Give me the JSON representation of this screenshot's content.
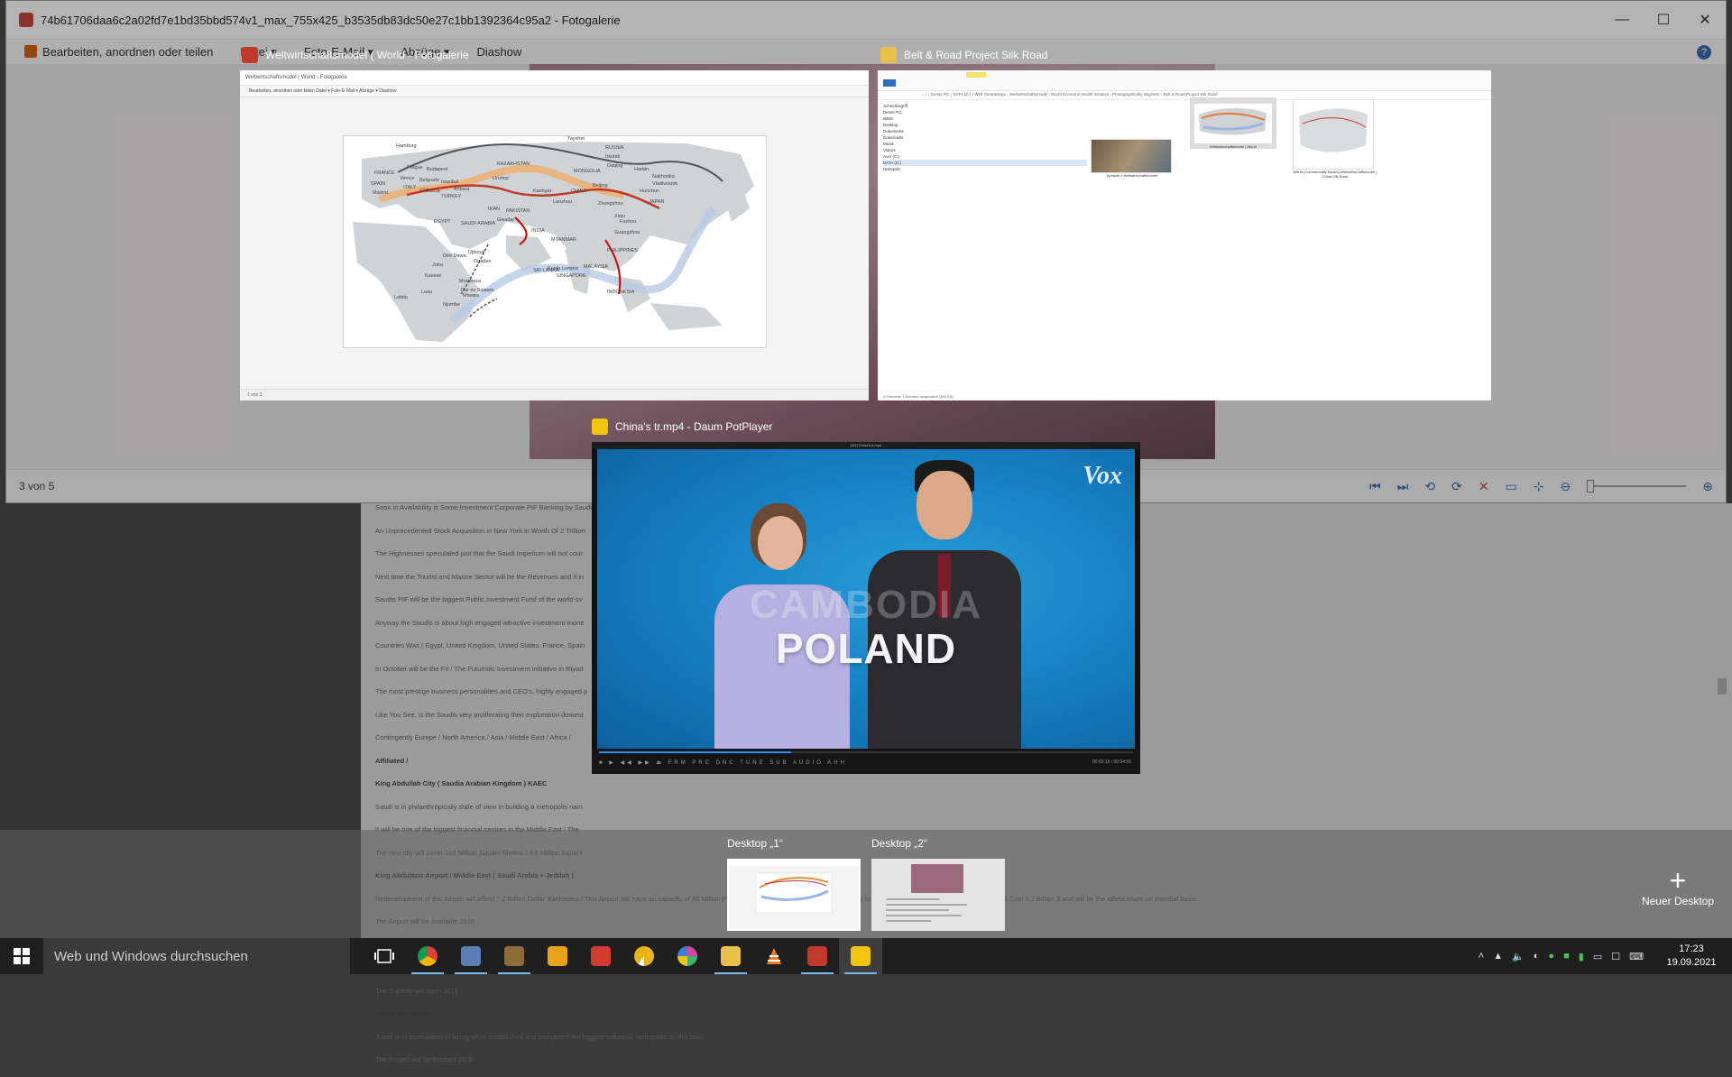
{
  "background_window": {
    "title": "74b61706daa6c2a02fd7e1bd35bbd574v1_max_755x425_b3535db83dc50e27c1bb1392364c95a2 - Fotogalerie",
    "menu": [
      {
        "label": "Bearbeiten, anordnen oder teilen"
      },
      {
        "label": "Datei ▾"
      },
      {
        "label": "Foto-E-Mail ▾"
      },
      {
        "label": "Abzüge ▾"
      },
      {
        "label": "Diashow"
      }
    ],
    "help": "?",
    "status_count": "3 von 5",
    "window_controls": {
      "minimize": "—",
      "maximize": "☐",
      "close": "✕"
    },
    "status_controls": [
      "⏮",
      "⏭",
      "⟲",
      "⟳",
      "✕",
      "▭",
      "⊹",
      "⊖",
      "⊕"
    ]
  },
  "document_text": [
    {
      "text": "Soon in Availability is Some Investment Corporate PIF Banking by Saudi",
      "bold": false
    },
    {
      "text": "An Unprecedented Stock Acquisition in New York in Worth Of 2 Trillion",
      "bold": false
    },
    {
      "text": "The Highnesses speculated just that the Saudi Imperium will not cour",
      "bold": false
    },
    {
      "text": "Next time the Tourist and Marine Sector will be the Revenues and if in",
      "bold": false
    },
    {
      "text": "Saudis PIF will be the biggest Public Investment Fund of the world ov",
      "bold": false
    },
    {
      "text": "Anyway the Saudis is about high engaged attractive investment mone",
      "bold": false
    },
    {
      "text": "Countries Was ( Egypt, United Kingdom, United States, France, Spain",
      "bold": false
    },
    {
      "text": "In October will be the FII / The Futuristic Investment Initiative in Riyad",
      "bold": false
    },
    {
      "text": "The most prestige business personalities and CEO's, highly engaged p",
      "bold": false
    },
    {
      "text": "Like You See, is the Saudis very proliferating their exploration domest",
      "bold": false
    },
    {
      "text": "Contingently Europe / North America / Asia / Middle East / Africa /",
      "bold": false
    },
    {
      "text": "Affiliated /",
      "bold": true
    },
    {
      "text": "King Abdullah City ( Saudia Arabian Kingdom ) KAEC",
      "bold": true
    },
    {
      "text": "Saudi is in philanthropically state of view in building a metropolis nam",
      "bold": false
    },
    {
      "text": "It will be one of the biggest financial centres in the Middle East / The",
      "bold": false
    },
    {
      "text": "The new city will cover 168 Million Square Meters / 4.5 Million Square",
      "bold": false
    },
    {
      "text": "King Abdulaziz Airport / Middle East ( Saudi Arabia + Jeddah )",
      "bold": true
    },
    {
      "text": "Redevelopment of this Airport will afford 7.2 Billion Dollar Banknotes / This Airport will have an capacity of 80 Million Passengers / This Airport will be in connectivity to an High Speed Train / The Control Tower Will Cost 3.2 Billion $ and will be the tallest tower on mondial basis.",
      "bold": false
    },
    {
      "text": "The Airport will be available 2018",
      "bold": false
    },
    {
      "text": "Riyadh Subway ( Saudi )",
      "bold": true
    },
    {
      "text": "The Construction Prize is estimated 22.5 Billion Dollar Bills",
      "bold": false
    },
    {
      "text": "The Subway will open 2019",
      "bold": false
    },
    {
      "text": "Jubail City Center",
      "bold": true
    },
    {
      "text": "Jubail is in speculation of being when established and completed the biggest industrial metropolis on this plan",
      "bold": false
    },
    {
      "text": "The Project will be finished 2026",
      "bold": false
    }
  ],
  "task_view": {
    "windows": [
      {
        "title": "Weltwirtschaftsmodel ( World - Fotogalerie",
        "inner_title": "Weltwirtschaftsmodel ( World - Fotogalerie",
        "inner_menu": "Bearbeiten, anordnen oder teilen     Datei ▾     Foto-E-Mail ▾     Abzüge ▾     Diashow",
        "inner_status": "1 von 3",
        "map_labels": {
          "hamburg": "Hamburg",
          "russia": "RUSSIA",
          "irkutsk": "Irkutsk",
          "tayshet": "Tayshet",
          "kazakhstan": "KAZAKHSTAN",
          "mongolia": "MONGOLIA",
          "prague": "Prague",
          "budapest": "Budapest",
          "france": "FRANCE",
          "venice": "Venice",
          "italy": "ITALY",
          "belgrade": "Belgrade",
          "istanbul": "Istanbul",
          "ankara": "Ankara",
          "greece": "GREECE",
          "turkey": "TURKEY",
          "spain": "SPAIN",
          "madrid": "Madrid",
          "urumqi": "Urumqi",
          "kashgar": "Kashgar",
          "china": "CHINA",
          "beijing": "Beijing",
          "daqing": "Daqing",
          "harbin": "Harbin",
          "nakhodka": "Nakhodka",
          "vladivostok": "Vladivostok",
          "hunchun": "Hunchun",
          "japan": "JAPAN",
          "iran": "IRAN",
          "pakistan": "PAKISTAN",
          "gwadar": "Gwadar",
          "egypt": "EGYPT",
          "saudi": "SAUDI ARABIA",
          "india": "INDIA",
          "zhengzhou": "Zhengzhou",
          "fuzhou": "Fuzhou",
          "guangzhou": "Guangzhou",
          "myanmar": "MYANMAR",
          "philippines": "PHILIPPINES",
          "djibouti": "Djibouti",
          "dire_dawa": "Dire Dawa",
          "ogaden": "Ogaden",
          "juba": "Juba",
          "kasese": "Kasese",
          "mombasa": "Mombasa",
          "dar": "Dar es Salaam",
          "mtwara": "Mtwara",
          "luau": "Luau",
          "lobito": "Lobito",
          "njombe": "Njombe",
          "sri_lanka": "SRI LANKA",
          "kuala": "Kuala Lumpur",
          "singapore": "SINGAPORE",
          "malaysia": "MALAYSIA",
          "indonesia": "INDONESIA",
          "xiwu": "Xiwu",
          "lanzhou": "Lanzhou"
        }
      },
      {
        "title": "Belt & Road Project Silk Road",
        "address": "‹  ›  ↑   Dieser PC  ›  DATA (D:)  ›  Welt Geneanlogy  ›  Weltwirtschaftsmodel  ›  World Economic Model Initiative  ›  Photographically Segment  ›  Belt & Road Project Silk Road",
        "nav": [
          "Schnellzugriff",
          "Dieser PC",
          "Bilder",
          "Desktop",
          "Dokumente",
          "Downloads",
          "Musik",
          "Videos",
          "Acer (C:)",
          "DATA (D:)",
          "Netzwerk"
        ],
        "files": [
          "Aphasik + Weltwirtschaftsmodel",
          "Weltwirtschaftsmodel ( World",
          "World (Commercially Model) (Weltwirtschaftsmodel ) China Silk Road"
        ],
        "status": "3 Elemente     1 Element ausgewählt (485 KB)"
      },
      {
        "title": "China's tr.mp4 - Daum PotPlayer",
        "inner_title": "[2/3] China's tr.mp4",
        "watermark": "Vox",
        "ghost_caption": "CAMBODIA",
        "caption": "POLAND",
        "controls": "■ ▶ ◀◀ ▶▶ ⏏   FRM   PRC   DNC   TUNE   SUB   AUDIO   AHH",
        "time": "00:02:15 / 00:04:56",
        "progress": 0.36
      }
    ],
    "desktops": [
      {
        "label": "Desktop „1“"
      },
      {
        "label": "Desktop „2“"
      }
    ],
    "new_desktop": {
      "icon": "+",
      "label": "Neuer Desktop"
    }
  },
  "taskbar": {
    "search_placeholder": "Web und Windows durchsuchen",
    "apps": [
      {
        "icon": "task-view-icon",
        "color": "#ffffff"
      },
      {
        "icon": "chrome-icon",
        "color": "#4285f4"
      },
      {
        "icon": "pdf-icon",
        "color": "#5b7fb5"
      },
      {
        "icon": "photo-app-icon",
        "color": "#8e6c3a"
      },
      {
        "icon": "paint-icon",
        "color": "#e8a317"
      },
      {
        "icon": "acrobat-icon",
        "color": "#d33b2c"
      },
      {
        "icon": "chrome-alt-icon",
        "color": "#e9b418"
      },
      {
        "icon": "picasa-icon",
        "color": "#d04ba0"
      },
      {
        "icon": "explorer-icon",
        "color": "#e8c04a"
      },
      {
        "icon": "vlc-icon",
        "color": "#ef7f1a"
      },
      {
        "icon": "photo-gallery-icon",
        "color": "#c0392b"
      },
      {
        "icon": "potplayer-icon",
        "color": "#f1c40f"
      }
    ],
    "time": "17:23",
    "date": "19.09.2021"
  }
}
